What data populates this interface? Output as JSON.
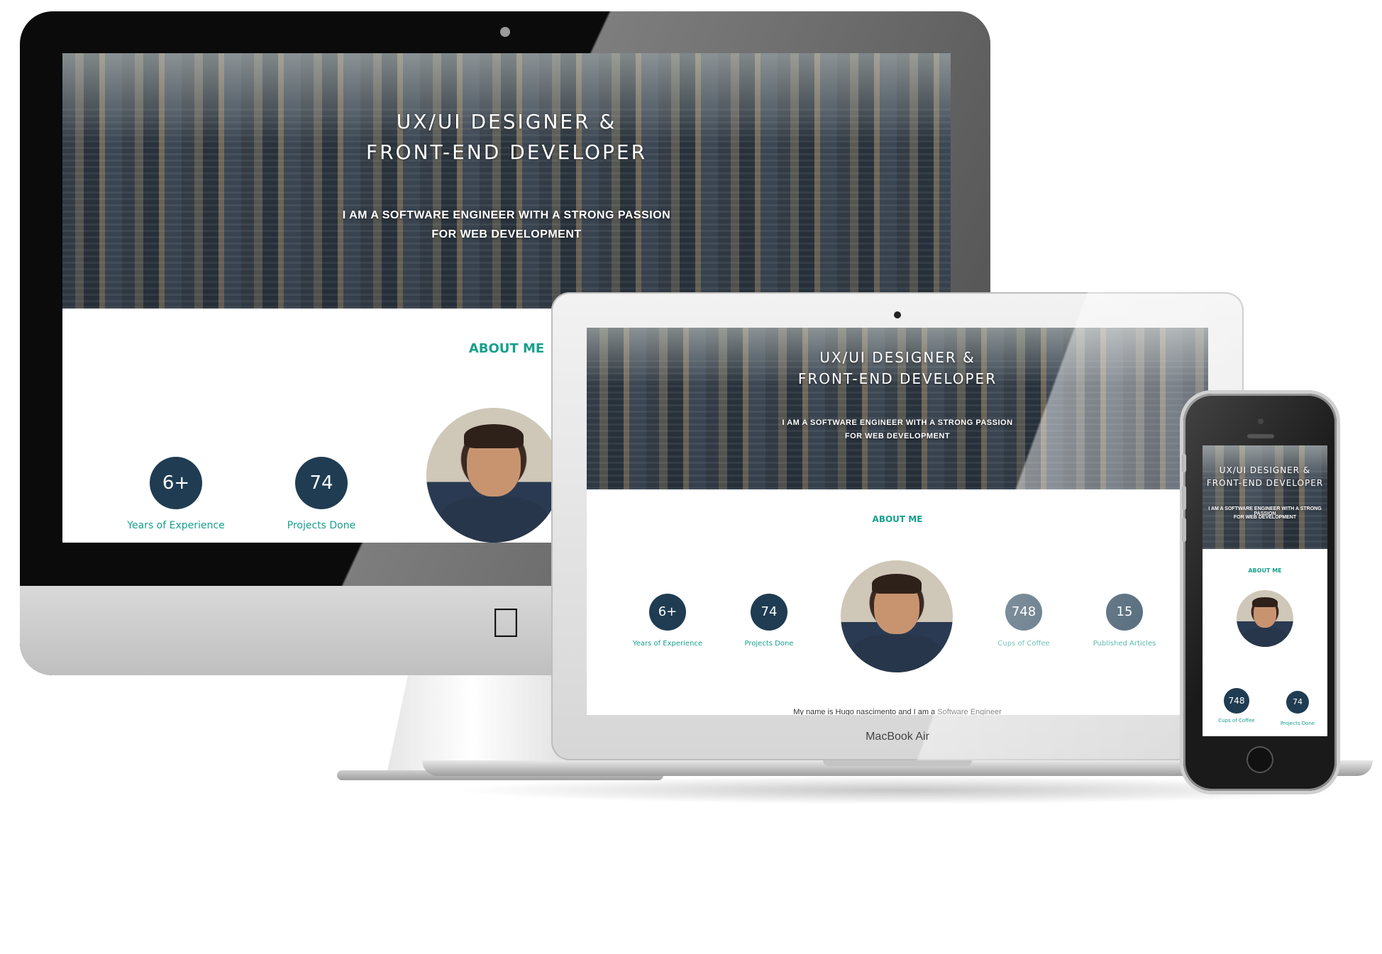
{
  "site": {
    "hero_title_line1": "UX/UI DESIGNER &",
    "hero_title_line2": "FRONT-END DEVELOPER",
    "hero_subtitle_line1": "I AM A SOFTWARE ENGINEER WITH A STRONG PASSION",
    "hero_subtitle_line2": "FOR WEB DEVELOPMENT",
    "about_heading": "ABOUT ME",
    "stats": [
      {
        "value": "6+",
        "label": "Years of Experience"
      },
      {
        "value": "74",
        "label": "Projects Done"
      },
      {
        "value": "748",
        "label": "Cups of Coffee"
      },
      {
        "value": "15",
        "label": "Published Articles"
      }
    ],
    "bio_line": "My name is Hugo nascimento and I am a Software Engineer"
  },
  "laptop": {
    "brand_label": "MacBook Air"
  },
  "colors": {
    "accent": "#17a08c",
    "stat_circle": "#1f3c52"
  },
  "icons": {
    "apple_logo": "apple-logo-icon"
  }
}
